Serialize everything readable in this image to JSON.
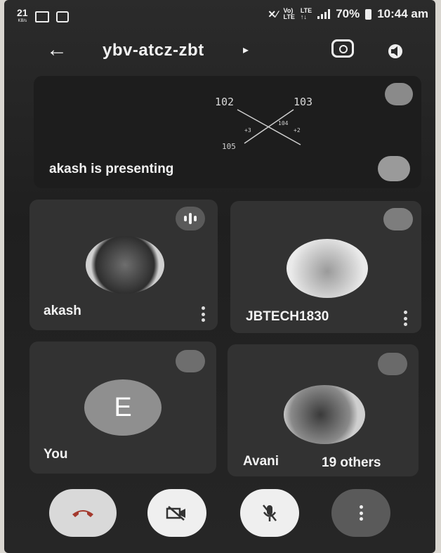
{
  "status_bar": {
    "speed_value": "21",
    "speed_unit": "KB/s",
    "volte_top": "Vo)",
    "volte_bottom": "LTE",
    "lte_top": "LTE",
    "lte_bottom": "↑↓",
    "battery": "70%",
    "time": "10:44 am"
  },
  "header": {
    "meeting_code": "ybv-atcz-zbt",
    "caret": "▸",
    "back_icon": "arrow-left-icon",
    "switch_camera_icon": "camera-switch-icon",
    "speaker_icon": "speaker-icon"
  },
  "presentation": {
    "label": "akash is presenting",
    "board_numbers": [
      "102",
      "103",
      "105",
      "104",
      "+3",
      "+2"
    ]
  },
  "participants": [
    {
      "name": "akash"
    },
    {
      "name": "JBTECH1830"
    },
    {
      "name": "You",
      "initial": "E"
    },
    {
      "name": "Avani",
      "extra": "19 others"
    }
  ],
  "controls": {
    "end_call_icon": "phone-hangup-icon",
    "camera_icon": "camera-off-icon",
    "mic_icon": "mic-off-icon",
    "more_icon": "more-vert-icon"
  },
  "colors": {
    "end_call": "#d9d9d9",
    "background": "#222222"
  }
}
